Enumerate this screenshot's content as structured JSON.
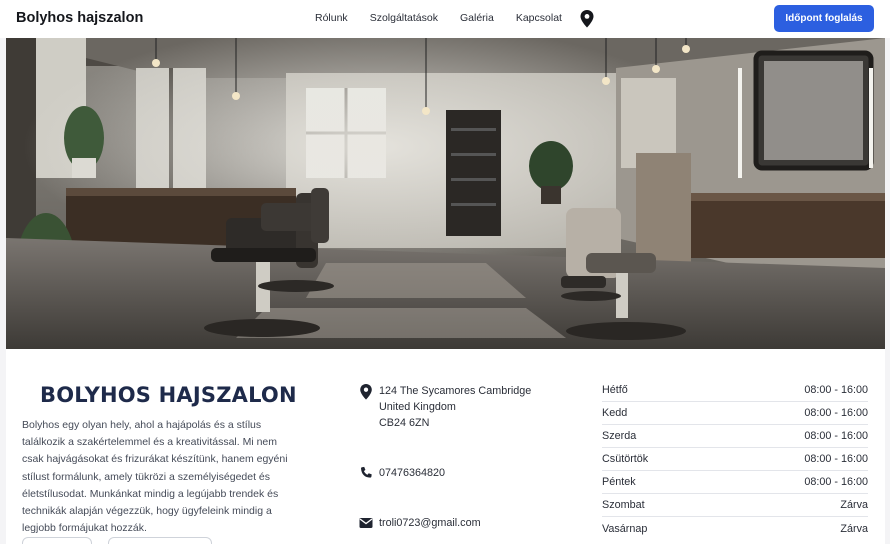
{
  "navbar": {
    "brand": "Bolyhos hajszalon",
    "links": [
      {
        "label": "Rólunk"
      },
      {
        "label": "Szolgáltatások"
      },
      {
        "label": "Galéria"
      },
      {
        "label": "Kapcsolat"
      }
    ],
    "location_icon": "map-pin-icon",
    "cta_label": "Időpont foglalás",
    "cta_color": "#2c5fe0"
  },
  "hero": {
    "image": "barber-shop-interior"
  },
  "about": {
    "title": "BOLYHOS HAJSZALON",
    "text": "Bolyhos egy olyan hely, ahol a hajápolás és a stílus találkozik a szakértelemmel és a kreativitással. Mi nem csak hajvágásokat és frizurákat készítünk, hanem egyéni stílust formálunk, amely tükrözi a személyiségedet és életstílusodat. Munkánkat mindig a legújabb trendek és technikák alapján végezzük, hogy ügyfeleink mindig a legjobb formájukat hozzák."
  },
  "contact": {
    "address": "124 The Sycamores Cambridge\nUnited Kingdom\nCB24 6ZN",
    "phone": "07476364820",
    "email": "troli0723@gmail.com",
    "icons": {
      "address": "map-pin-icon",
      "phone": "phone-icon",
      "email": "mail-icon"
    }
  },
  "hours": [
    {
      "day": "Hétfő",
      "time": "08:00 - 16:00"
    },
    {
      "day": "Kedd",
      "time": "08:00 - 16:00"
    },
    {
      "day": "Szerda",
      "time": "08:00 - 16:00"
    },
    {
      "day": "Csütörtök",
      "time": "08:00 - 16:00"
    },
    {
      "day": "Péntek",
      "time": "08:00 - 16:00"
    },
    {
      "day": "Szombat",
      "time": "Zárva"
    },
    {
      "day": "Vasárnap",
      "time": "Zárva"
    }
  ]
}
